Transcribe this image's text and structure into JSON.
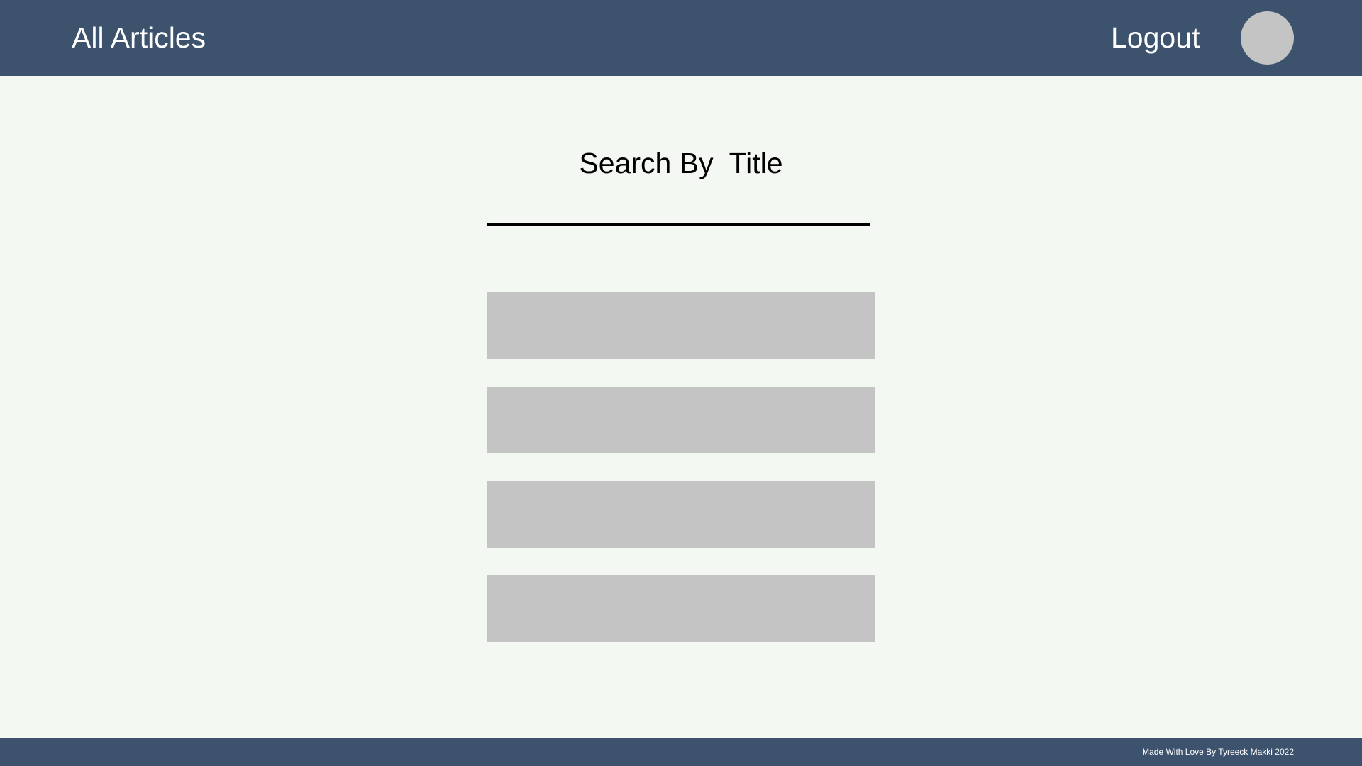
{
  "header": {
    "title": "All Articles",
    "logout_label": "Logout"
  },
  "search": {
    "title": "Search By  Title",
    "value": "",
    "placeholder": ""
  },
  "articles": [
    {
      "title": ""
    },
    {
      "title": ""
    },
    {
      "title": ""
    },
    {
      "title": ""
    }
  ],
  "footer": {
    "credit": "Made With Love By Tyreeck Makki 2022"
  },
  "colors": {
    "header_bg": "#3c526d",
    "page_bg": "#f4f8f3",
    "placeholder_gray": "#c4c4c4"
  }
}
